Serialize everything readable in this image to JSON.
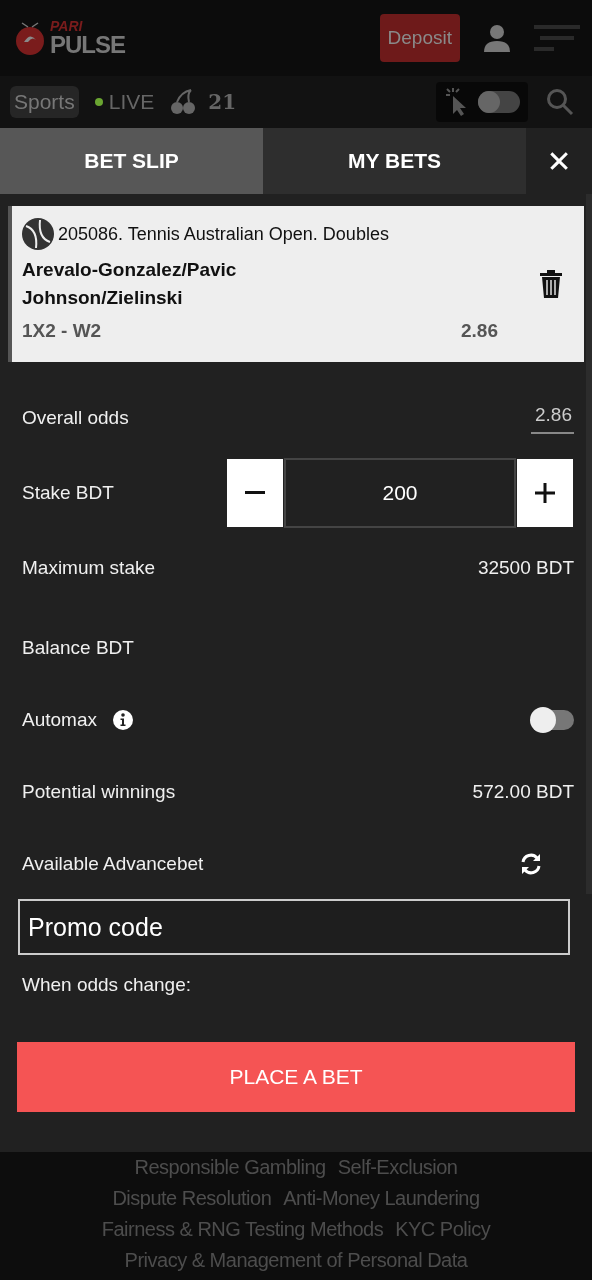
{
  "header": {
    "logo_top": "PARI",
    "logo_bottom": "PULSE",
    "deposit_button": "Deposit"
  },
  "nav": {
    "items": [
      {
        "label": "Sports",
        "selected": true
      },
      {
        "label": "LIVE",
        "selected": false
      }
    ],
    "number_item": "21",
    "toggle_on": false
  },
  "tabs": [
    {
      "label": "BET SLIP",
      "selected": true
    },
    {
      "label": "MY BETS",
      "selected": false
    }
  ],
  "close_icon": "✕",
  "bet": {
    "event": "205086. Tennis Australian Open. Doubles",
    "team_1": "Arevalo-Gonzalez/Pavic",
    "team_2": "Johnson/Zielinski",
    "market": "1X2 - W2",
    "odds": "2.86"
  },
  "rows": [
    {
      "kind": "odds",
      "label": "Overall odds",
      "value": "2.86"
    },
    {
      "kind": "stake",
      "label": "Stake BDT",
      "value": "200"
    },
    {
      "kind": "value",
      "label": "Maximum stake",
      "value": "32500 BDT"
    },
    {
      "kind": "value",
      "label": "Balance BDT"
    },
    {
      "kind": "toggle",
      "label": "Automax",
      "on": false
    },
    {
      "kind": "value",
      "label": "Potential winnings",
      "value": "572.00 BDT"
    },
    {
      "kind": "refresh",
      "label": "Available Advancebet"
    },
    {
      "kind": "promo",
      "placeholder": "Promo code"
    },
    {
      "kind": "text",
      "label": "When odds change:"
    }
  ],
  "place_bet_button": "PLACE A BET",
  "footer_links": [
    [
      "Responsible Gambling",
      "Self-Exclusion"
    ],
    [
      "Dispute Resolution",
      "Anti-Money Laundering"
    ],
    [
      "Fairness & RNG Testing Methods",
      "KYC Policy"
    ],
    [
      "Privacy & Management of Personal Data"
    ]
  ]
}
